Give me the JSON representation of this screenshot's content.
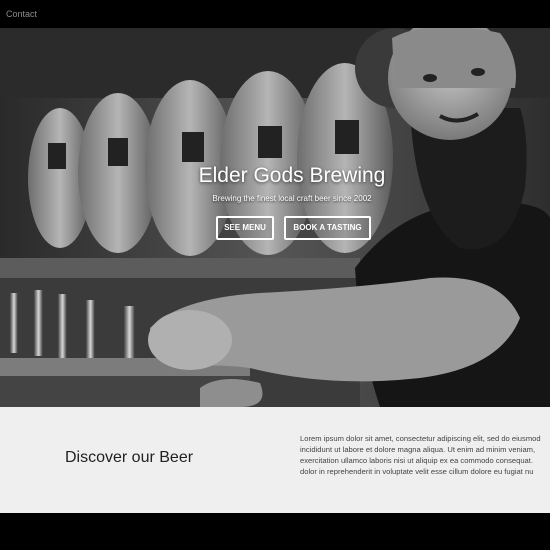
{
  "nav": {
    "contact_label": "Contact"
  },
  "hero": {
    "title": "Elder Gods Brewing",
    "subtitle": "Brewing the finest local craft beer since 2002",
    "menu_button": "SEE MENU",
    "tasting_button": "BOOK A TASTING"
  },
  "discover": {
    "heading": "Discover our Beer",
    "lines": [
      "Lorem ipsum dolor sit amet, consectetur adipiscing elit, sed do eiusmod",
      "incididunt ut labore et dolore magna aliqua. Ut enim ad minim veniam,",
      "exercitation ullamco laboris nisi ut aliquip ex ea commodo consequat.",
      "dolor in reprehenderit in voluptate velit esse cillum dolore eu fugiat nu"
    ]
  },
  "colors": {
    "topbar": "#000000",
    "section_bg": "#efefef",
    "footer": "#000000"
  }
}
